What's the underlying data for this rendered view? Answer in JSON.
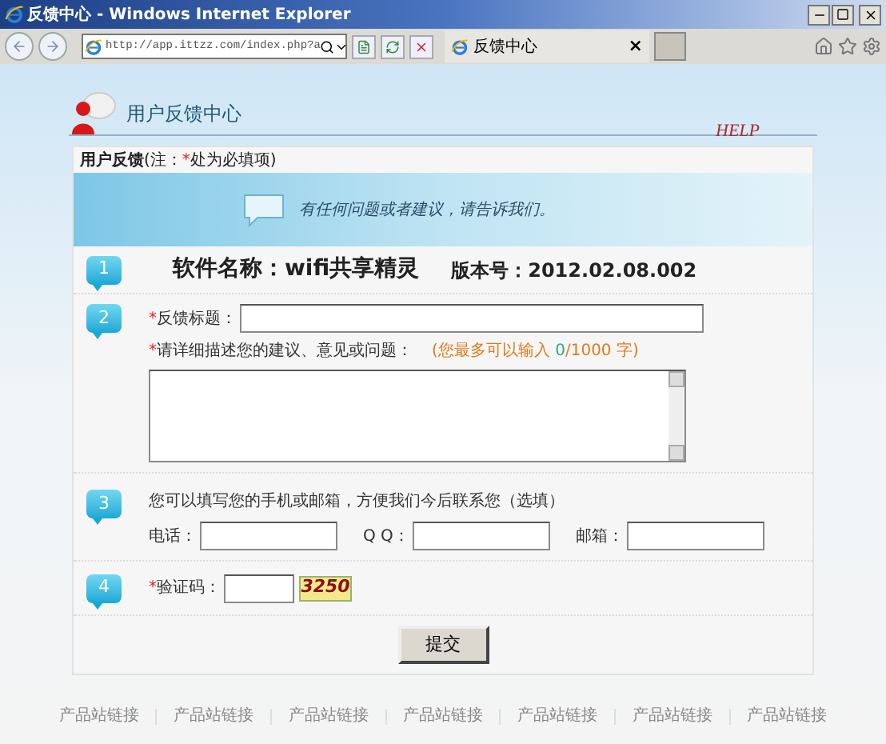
{
  "window": {
    "title": "反馈中心 - Windows Internet Explorer"
  },
  "browser": {
    "address": "http://app.ittzz.com/index.php?a",
    "tab_title": "反馈中心",
    "tab_close": "×"
  },
  "page": {
    "header_title": "用户反馈中心",
    "help": "HELP",
    "note": {
      "title": "用户反馈",
      "prefix": "(注：",
      "mark": "*",
      "suffix": "处为必填项)"
    },
    "banner_text": "有任何问题或者建议，请告诉我们。",
    "steps": [
      {
        "number": "1",
        "kind": "info",
        "software": "软件名称：wifi共享精灵",
        "version": "版本号：2012.02.08.002"
      },
      {
        "number": "2",
        "kind": "feedback",
        "mark": "*",
        "title_label": "反馈标题：",
        "detail_label": "请详细描述您的建议、意见或问题：",
        "limit_prefix": "(您最多可以输入 ",
        "count": "0",
        "limit_suffix": "/1000 字)"
      },
      {
        "number": "3",
        "kind": "contact",
        "intro": "您可以填写您的手机或邮箱，方便我们今后联系您（选填）",
        "fields": [
          {
            "label": "电话："
          },
          {
            "label": "Q Q："
          },
          {
            "label": "邮箱："
          }
        ]
      },
      {
        "number": "4",
        "kind": "captcha",
        "mark": "*",
        "label": "验证码：",
        "captcha": "3250"
      }
    ],
    "submit": "提交",
    "footer_links": [
      "产品站链接",
      "产品站链接",
      "产品站链接",
      "产品站链接",
      "产品站链接",
      "产品站链接",
      "产品站链接"
    ]
  }
}
